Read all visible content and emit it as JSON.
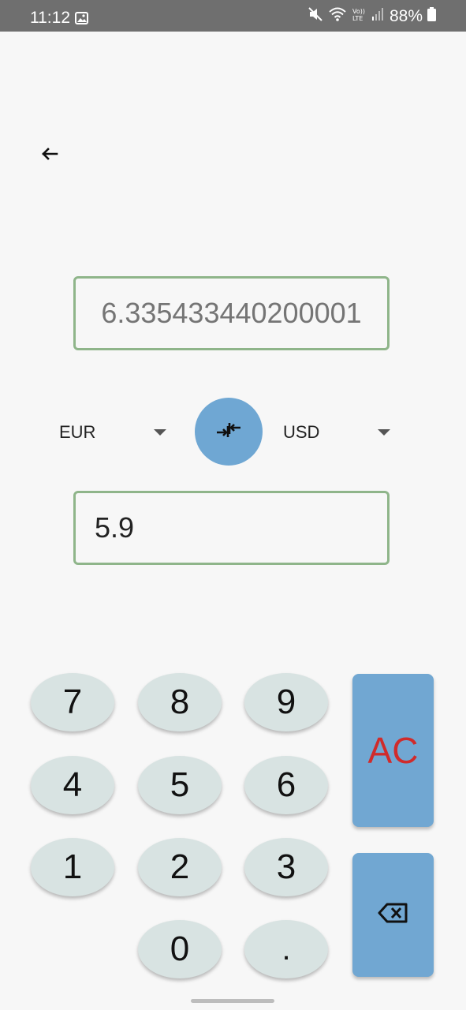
{
  "status_bar": {
    "time": "11:12",
    "battery": "88%"
  },
  "converter": {
    "input_value": "6.335433440200001",
    "output_value": "5.9",
    "from_currency": "EUR",
    "to_currency": "USD"
  },
  "keypad": {
    "keys": [
      "7",
      "8",
      "9",
      "4",
      "5",
      "6",
      "1",
      "2",
      "3",
      "0",
      "."
    ],
    "clear_label": "AC"
  },
  "colors": {
    "accent_blue": "#6fa7d3",
    "field_border": "#8fb58a",
    "clear_text": "#d02b2b",
    "key_bg": "#d8e3e2"
  }
}
